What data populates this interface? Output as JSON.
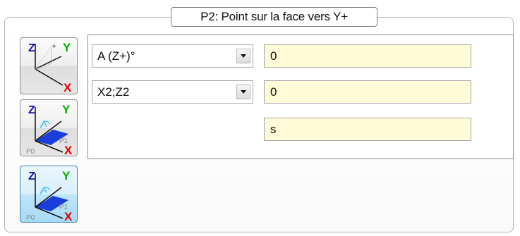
{
  "panel": {
    "title": "P2: Point sur la face vers Y+"
  },
  "icon_buttons": [
    {
      "name": "axes-angle-mode",
      "state": "normal",
      "axis_labels": {
        "z": "Z",
        "y": "Y",
        "x": "X"
      }
    },
    {
      "name": "axes-plane-points-mode",
      "state": "normal",
      "axis_labels": {
        "z": "Z",
        "y": "Y",
        "x": "X",
        "a": "A",
        "p0": "P0",
        "p1": "P1"
      }
    },
    {
      "name": "axes-plane-points-mode-alt",
      "state": "selected",
      "axis_labels": {
        "z": "Z",
        "y": "Y",
        "x": "X",
        "a": "A",
        "p0": "P0",
        "p1": "P1"
      }
    }
  ],
  "combos": [
    {
      "selected": "A (Z+)°"
    },
    {
      "selected": "X2;Z2"
    }
  ],
  "fields": [
    {
      "value": "0"
    },
    {
      "value": "0"
    },
    {
      "value": "s"
    }
  ],
  "colors": {
    "field_background": "#fffbd9",
    "selected_button": "#bee6fd",
    "axis_x": "#e00000",
    "axis_y": "#00c000",
    "axis_z": "#0000c0",
    "plane": "#1034d8"
  }
}
